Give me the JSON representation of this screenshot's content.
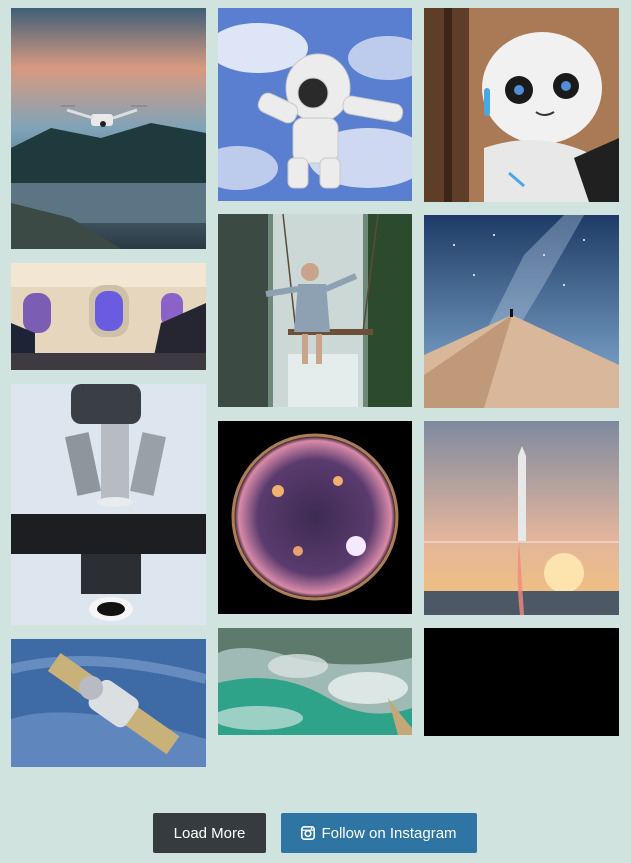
{
  "gallery": {
    "items": [
      {
        "id": "drone",
        "icon": "drone-image"
      },
      {
        "id": "airplane-windows",
        "icon": "airplane-window-image"
      },
      {
        "id": "microscope",
        "icon": "microscope-image"
      },
      {
        "id": "spacecraft",
        "icon": "spacecraft-image"
      },
      {
        "id": "astronaut",
        "icon": "astronaut-image"
      },
      {
        "id": "swing-waterfall",
        "icon": "swing-image"
      },
      {
        "id": "sun",
        "icon": "sun-image"
      },
      {
        "id": "island",
        "icon": "island-image"
      },
      {
        "id": "robot",
        "icon": "robot-image"
      },
      {
        "id": "desert-stars",
        "icon": "desert-image"
      },
      {
        "id": "rocket-launch",
        "icon": "rocket-image"
      },
      {
        "id": "black-placeholder",
        "icon": "blank-image"
      }
    ]
  },
  "buttons": {
    "load_more": "Load More",
    "follow": "Follow on Instagram",
    "follow_icon": "instagram-icon"
  },
  "colors": {
    "background": "#d0e3df",
    "load_more_bg": "#353b3f",
    "follow_bg": "#2e75a4"
  }
}
